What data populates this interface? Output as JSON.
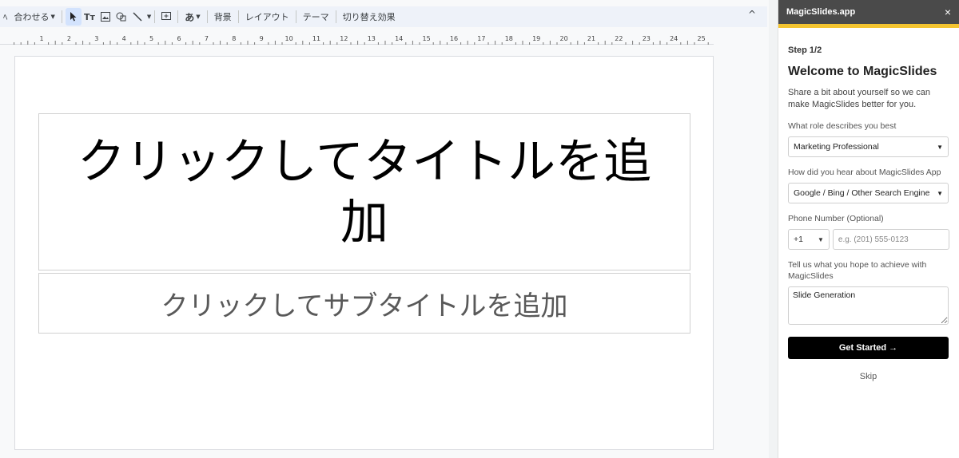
{
  "toolbar": {
    "fit_label": "合わせる",
    "text_icon": "Tт",
    "aa_label": "あ",
    "background": "背景",
    "layout": "レイアウト",
    "theme": "テーマ",
    "transition": "切り替え効果",
    "collapse_icon": "^"
  },
  "ruler": {
    "ticks": [
      "1",
      "2",
      "3",
      "4",
      "5",
      "6",
      "7",
      "8",
      "9",
      "10",
      "11",
      "12",
      "13",
      "14",
      "15",
      "16",
      "17",
      "18",
      "19",
      "20",
      "21",
      "22",
      "23",
      "24",
      "25"
    ]
  },
  "slide": {
    "title_placeholder": "クリックしてタイトルを追加",
    "subtitle_placeholder": "クリックしてサブタイトルを追加"
  },
  "panel": {
    "header_title": "MagicSlides.app",
    "close": "×",
    "accent_color": "#f4c430",
    "step": "Step 1/2",
    "heading": "Welcome to MagicSlides",
    "intro": "Share a bit about yourself so we can make MagicSlides better for you.",
    "role_label": "What role describes you best",
    "role_value": "Marketing Professional",
    "source_label": "How did you hear about MagicSlides App",
    "source_value": "Google / Bing / Other Search Engine",
    "phone_label": "Phone Number (Optional)",
    "country_code": "+1",
    "phone_placeholder": "e.g. (201) 555-0123",
    "goal_label": "Tell us what you hope to achieve with MagicSlides",
    "goal_value": "Slide Generation",
    "cta": "Get Started →",
    "skip": "Skip"
  }
}
